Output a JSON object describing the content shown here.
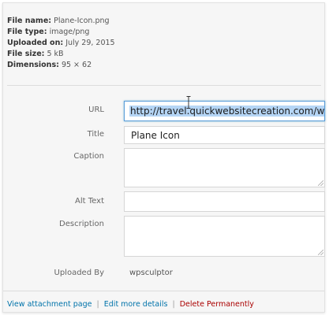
{
  "file_info": {
    "name_label": "File name:",
    "name_value": "Plane-Icon.png",
    "type_label": "File type:",
    "type_value": "image/png",
    "uploaded_label": "Uploaded on:",
    "uploaded_value": "July 29, 2015",
    "size_label": "File size:",
    "size_value": "5 kB",
    "dimensions_label": "Dimensions:",
    "dimensions_value": "95 × 62"
  },
  "fields": {
    "url_label": "URL",
    "url_value": "http://travel.quickwebsitecreation.com/wp",
    "title_label": "Title",
    "title_value": "Plane Icon",
    "caption_label": "Caption",
    "caption_value": "",
    "alt_label": "Alt Text",
    "alt_value": "",
    "description_label": "Description",
    "description_value": "",
    "uploaded_by_label": "Uploaded By",
    "uploaded_by_value": "wpsculptor"
  },
  "actions": {
    "view_attachment": "View attachment page",
    "edit_details": "Edit more details",
    "delete": "Delete Permanently",
    "separator": "|"
  },
  "colors": {
    "link": "#0073aa",
    "danger": "#a00000",
    "focus_border": "#5b9dd9",
    "selection": "#b5d5f5"
  }
}
